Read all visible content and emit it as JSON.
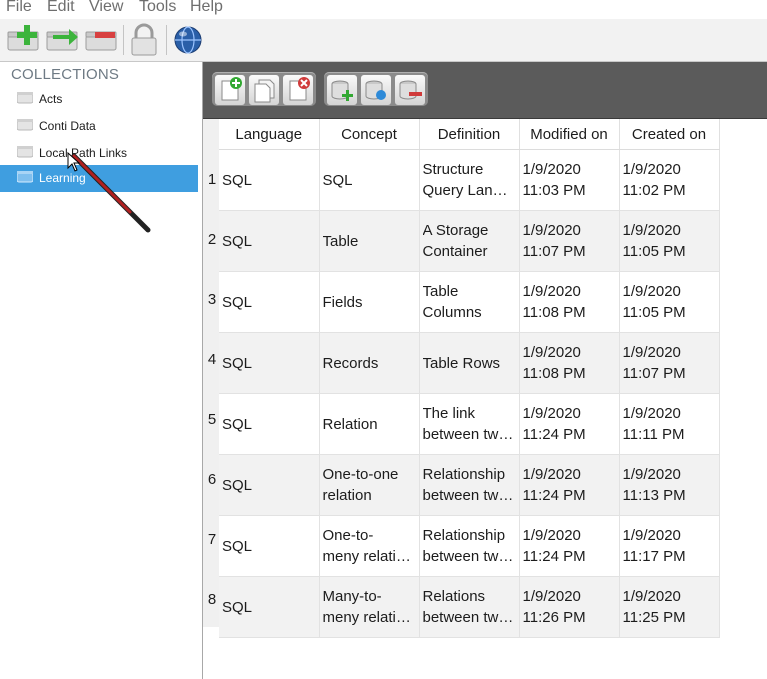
{
  "menu": [
    "File",
    "Edit",
    "View",
    "Tools",
    "Help"
  ],
  "toolbar": {
    "buttons": [
      "add-collection-icon",
      "move-collection-icon",
      "remove-collection-icon",
      "lock-icon",
      "globe-icon"
    ]
  },
  "sidebar": {
    "header": "COLLECTIONS",
    "items": [
      {
        "label": "Acts"
      },
      {
        "label": "Conti Data"
      },
      {
        "label": "Local Path Links"
      },
      {
        "label": "Learning"
      }
    ]
  },
  "grid_toolbar": {
    "group1": [
      "add-record-icon",
      "copy-record-icon",
      "delete-record-icon"
    ],
    "group2": [
      "add-field-icon",
      "edit-field-icon",
      "remove-field-icon"
    ]
  },
  "table": {
    "columns": [
      "Language",
      "Concept",
      "Definition",
      "Modified on",
      "Created on"
    ],
    "rows": [
      {
        "n": "1",
        "language": "SQL",
        "concept": [
          "SQL",
          ""
        ],
        "definition": [
          "Structure",
          "Query Lan…"
        ],
        "modified": [
          "1/9/2020",
          "11:03 PM"
        ],
        "created": [
          "1/9/2020",
          "11:02 PM"
        ]
      },
      {
        "n": "2",
        "language": "SQL",
        "concept": [
          "Table",
          ""
        ],
        "definition": [
          "A Storage",
          "Container"
        ],
        "modified": [
          "1/9/2020",
          "11:07 PM"
        ],
        "created": [
          "1/9/2020",
          "11:05 PM"
        ]
      },
      {
        "n": "3",
        "language": "SQL",
        "concept": [
          "Fields",
          ""
        ],
        "definition": [
          "Table",
          "Columns"
        ],
        "modified": [
          "1/9/2020",
          "11:08 PM"
        ],
        "created": [
          "1/9/2020",
          "11:05 PM"
        ]
      },
      {
        "n": "4",
        "language": "SQL",
        "concept": [
          "Records",
          ""
        ],
        "definition": [
          "Table Rows",
          ""
        ],
        "modified": [
          "1/9/2020",
          "11:08 PM"
        ],
        "created": [
          "1/9/2020",
          "11:07 PM"
        ]
      },
      {
        "n": "5",
        "language": "SQL",
        "concept": [
          "Relation",
          ""
        ],
        "definition": [
          "The link",
          "between tw…"
        ],
        "modified": [
          "1/9/2020",
          "11:24 PM"
        ],
        "created": [
          "1/9/2020",
          "11:11 PM"
        ]
      },
      {
        "n": "6",
        "language": "SQL",
        "concept": [
          "One-to-one",
          "relation"
        ],
        "definition": [
          "Relationship",
          "between tw…"
        ],
        "modified": [
          "1/9/2020",
          "11:24 PM"
        ],
        "created": [
          "1/9/2020",
          "11:13 PM"
        ]
      },
      {
        "n": "7",
        "language": "SQL",
        "concept": [
          "One-to-",
          "meny relati…"
        ],
        "definition": [
          "Relationship",
          "between tw…"
        ],
        "modified": [
          "1/9/2020",
          "11:24 PM"
        ],
        "created": [
          "1/9/2020",
          "11:17 PM"
        ]
      },
      {
        "n": "8",
        "language": "SQL",
        "concept": [
          "Many-to-",
          "meny relati…"
        ],
        "definition": [
          "Relations",
          "between tw…"
        ],
        "modified": [
          "1/9/2020",
          "11:26 PM"
        ],
        "created": [
          "1/9/2020",
          "11:25 PM"
        ]
      }
    ]
  },
  "colors": {
    "selection": "#3f9ee0",
    "toolbar_dark": "#5b5b5b",
    "row_alt": "#f2f2f2"
  }
}
